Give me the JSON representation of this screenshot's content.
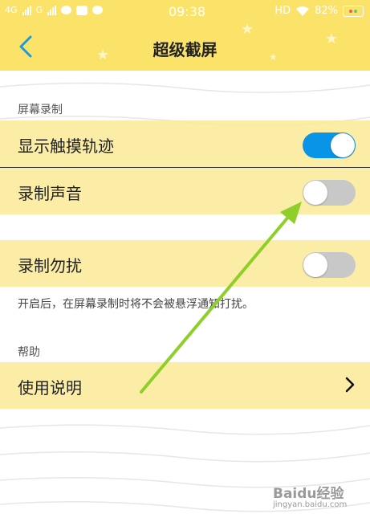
{
  "status_bar": {
    "left_network": "4G",
    "left_network2": "G",
    "time": "09:38",
    "hd": "HD",
    "battery": "82%"
  },
  "header": {
    "title": "超级截屏"
  },
  "sections": {
    "screen_recording": "屏幕录制",
    "help": "帮助"
  },
  "settings": {
    "show_touch": {
      "label": "显示触摸轨迹",
      "on": true
    },
    "record_sound": {
      "label": "录制声音",
      "on": false
    },
    "do_not_disturb": {
      "label": "录制勿扰",
      "on": false
    },
    "dnd_hint": "开启后，在屏幕录制时将不会被悬浮通知打扰。"
  },
  "help": {
    "instructions": "使用说明"
  },
  "watermark": {
    "brand": "Baidu经验",
    "url": "jingyan.baidu.com"
  },
  "colors": {
    "header_bg": "#fbe36a",
    "row_bg": "#fbea96",
    "toggle_on": "#0a94e8",
    "toggle_off": "#c8c8c8",
    "arrow": "#8fcf2a",
    "back_icon": "#1a9be0"
  }
}
